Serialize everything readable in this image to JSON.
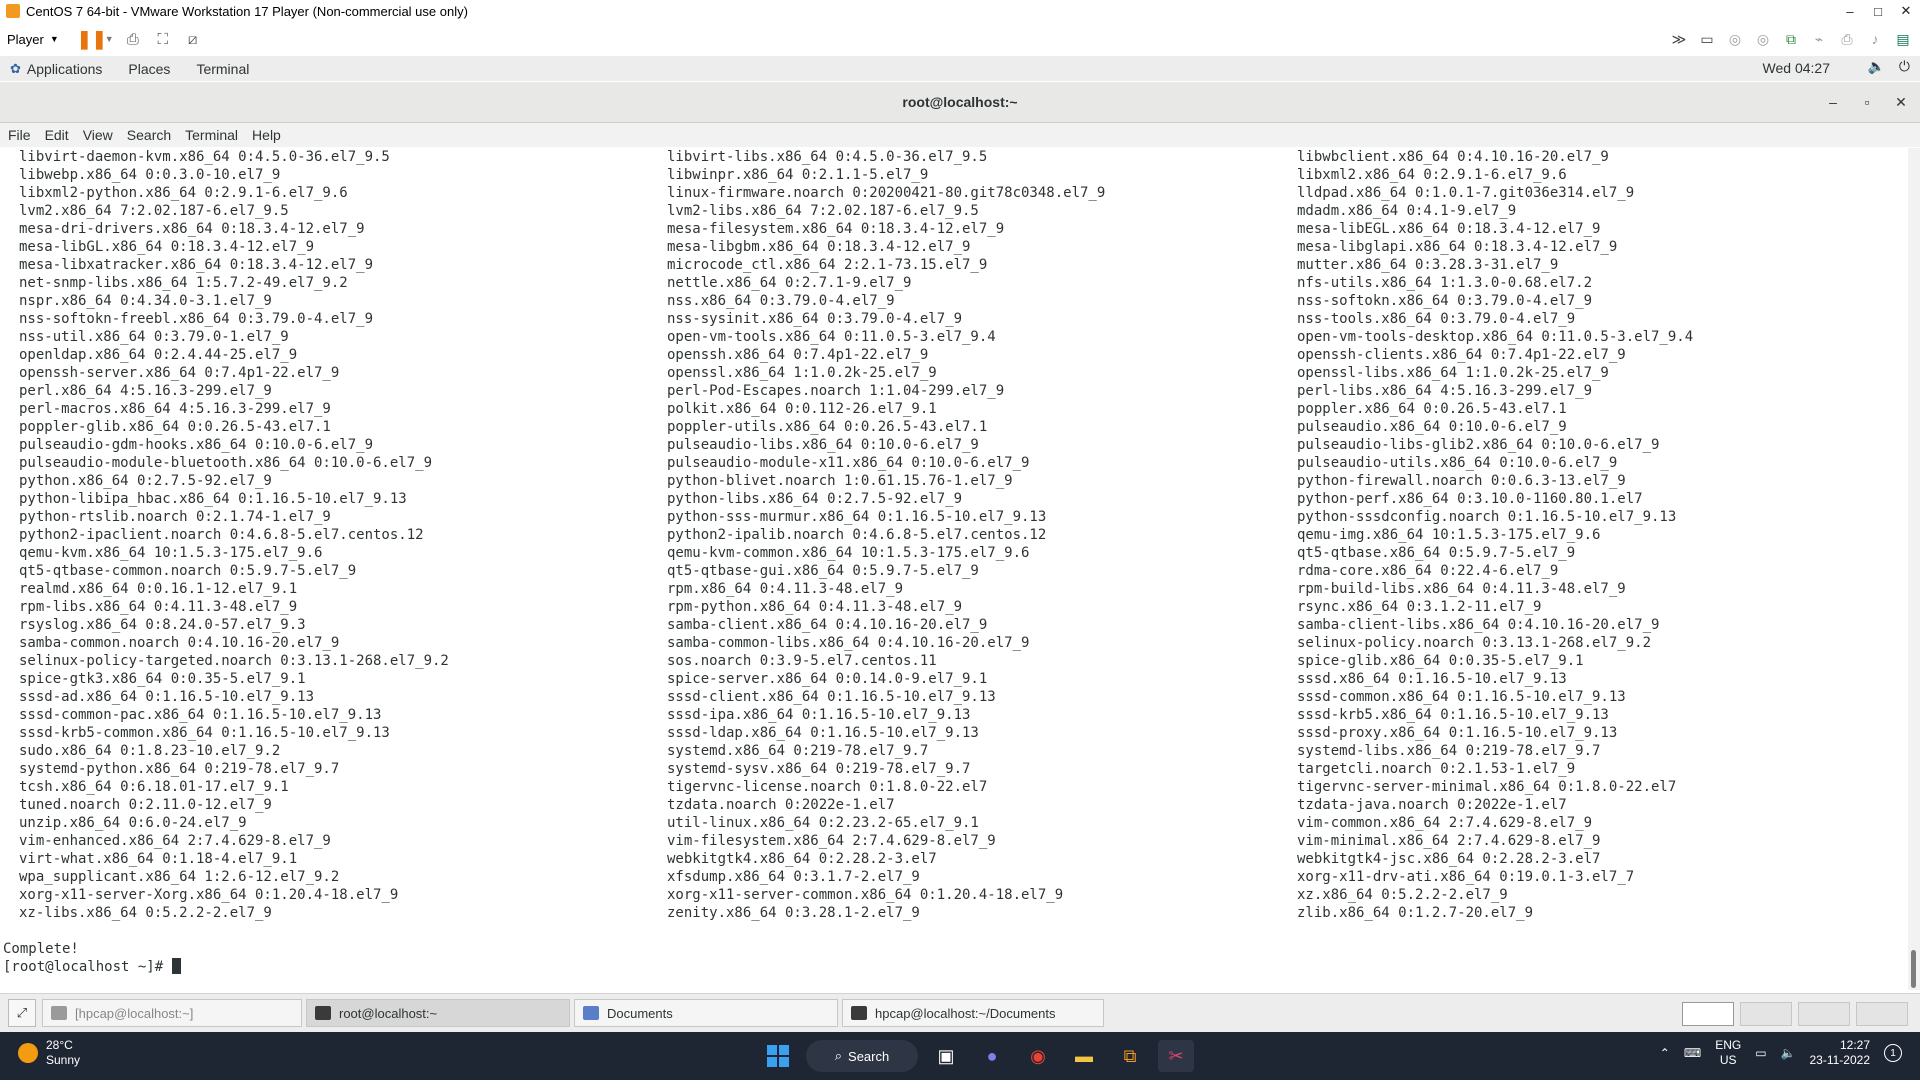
{
  "vm": {
    "title": "CentOS 7 64-bit - VMware Workstation 17 Player (Non-commercial use only)",
    "player_label": "Player",
    "minimize": "–",
    "maximize": "□",
    "close": "✕"
  },
  "gnome": {
    "menu": [
      "Applications",
      "Places",
      "Terminal"
    ],
    "clock": "Wed 04:27"
  },
  "terminal": {
    "title": "root@localhost:~",
    "menu": [
      "File",
      "Edit",
      "View",
      "Search",
      "Terminal",
      "Help"
    ],
    "rows": [
      [
        "libvirt-daemon-kvm.x86_64 0:4.5.0-36.el7_9.5",
        "libvirt-libs.x86_64 0:4.5.0-36.el7_9.5",
        "libwbclient.x86_64 0:4.10.16-20.el7_9"
      ],
      [
        "libwebp.x86_64 0:0.3.0-10.el7_9",
        "libwinpr.x86_64 0:2.1.1-5.el7_9",
        "libxml2.x86_64 0:2.9.1-6.el7_9.6"
      ],
      [
        "libxml2-python.x86_64 0:2.9.1-6.el7_9.6",
        "linux-firmware.noarch 0:20200421-80.git78c0348.el7_9",
        "lldpad.x86_64 0:1.0.1-7.git036e314.el7_9"
      ],
      [
        "lvm2.x86_64 7:2.02.187-6.el7_9.5",
        "lvm2-libs.x86_64 7:2.02.187-6.el7_9.5",
        "mdadm.x86_64 0:4.1-9.el7_9"
      ],
      [
        "mesa-dri-drivers.x86_64 0:18.3.4-12.el7_9",
        "mesa-filesystem.x86_64 0:18.3.4-12.el7_9",
        "mesa-libEGL.x86_64 0:18.3.4-12.el7_9"
      ],
      [
        "mesa-libGL.x86_64 0:18.3.4-12.el7_9",
        "mesa-libgbm.x86_64 0:18.3.4-12.el7_9",
        "mesa-libglapi.x86_64 0:18.3.4-12.el7_9"
      ],
      [
        "mesa-libxatracker.x86_64 0:18.3.4-12.el7_9",
        "microcode_ctl.x86_64 2:2.1-73.15.el7_9",
        "mutter.x86_64 0:3.28.3-31.el7_9"
      ],
      [
        "net-snmp-libs.x86_64 1:5.7.2-49.el7_9.2",
        "nettle.x86_64 0:2.7.1-9.el7_9",
        "nfs-utils.x86_64 1:1.3.0-0.68.el7.2"
      ],
      [
        "nspr.x86_64 0:4.34.0-3.1.el7_9",
        "nss.x86_64 0:3.79.0-4.el7_9",
        "nss-softokn.x86_64 0:3.79.0-4.el7_9"
      ],
      [
        "nss-softokn-freebl.x86_64 0:3.79.0-4.el7_9",
        "nss-sysinit.x86_64 0:3.79.0-4.el7_9",
        "nss-tools.x86_64 0:3.79.0-4.el7_9"
      ],
      [
        "nss-util.x86_64 0:3.79.0-1.el7_9",
        "open-vm-tools.x86_64 0:11.0.5-3.el7_9.4",
        "open-vm-tools-desktop.x86_64 0:11.0.5-3.el7_9.4"
      ],
      [
        "openldap.x86_64 0:2.4.44-25.el7_9",
        "openssh.x86_64 0:7.4p1-22.el7_9",
        "openssh-clients.x86_64 0:7.4p1-22.el7_9"
      ],
      [
        "openssh-server.x86_64 0:7.4p1-22.el7_9",
        "openssl.x86_64 1:1.0.2k-25.el7_9",
        "openssl-libs.x86_64 1:1.0.2k-25.el7_9"
      ],
      [
        "perl.x86_64 4:5.16.3-299.el7_9",
        "perl-Pod-Escapes.noarch 1:1.04-299.el7_9",
        "perl-libs.x86_64 4:5.16.3-299.el7_9"
      ],
      [
        "perl-macros.x86_64 4:5.16.3-299.el7_9",
        "polkit.x86_64 0:0.112-26.el7_9.1",
        "poppler.x86_64 0:0.26.5-43.el7.1"
      ],
      [
        "poppler-glib.x86_64 0:0.26.5-43.el7.1",
        "poppler-utils.x86_64 0:0.26.5-43.el7.1",
        "pulseaudio.x86_64 0:10.0-6.el7_9"
      ],
      [
        "pulseaudio-gdm-hooks.x86_64 0:10.0-6.el7_9",
        "pulseaudio-libs.x86_64 0:10.0-6.el7_9",
        "pulseaudio-libs-glib2.x86_64 0:10.0-6.el7_9"
      ],
      [
        "pulseaudio-module-bluetooth.x86_64 0:10.0-6.el7_9",
        "pulseaudio-module-x11.x86_64 0:10.0-6.el7_9",
        "pulseaudio-utils.x86_64 0:10.0-6.el7_9"
      ],
      [
        "python.x86_64 0:2.7.5-92.el7_9",
        "python-blivet.noarch 1:0.61.15.76-1.el7_9",
        "python-firewall.noarch 0:0.6.3-13.el7_9"
      ],
      [
        "python-libipa_hbac.x86_64 0:1.16.5-10.el7_9.13",
        "python-libs.x86_64 0:2.7.5-92.el7_9",
        "python-perf.x86_64 0:3.10.0-1160.80.1.el7"
      ],
      [
        "python-rtslib.noarch 0:2.1.74-1.el7_9",
        "python-sss-murmur.x86_64 0:1.16.5-10.el7_9.13",
        "python-sssdconfig.noarch 0:1.16.5-10.el7_9.13"
      ],
      [
        "python2-ipaclient.noarch 0:4.6.8-5.el7.centos.12",
        "python2-ipalib.noarch 0:4.6.8-5.el7.centos.12",
        "qemu-img.x86_64 10:1.5.3-175.el7_9.6"
      ],
      [
        "qemu-kvm.x86_64 10:1.5.3-175.el7_9.6",
        "qemu-kvm-common.x86_64 10:1.5.3-175.el7_9.6",
        "qt5-qtbase.x86_64 0:5.9.7-5.el7_9"
      ],
      [
        "qt5-qtbase-common.noarch 0:5.9.7-5.el7_9",
        "qt5-qtbase-gui.x86_64 0:5.9.7-5.el7_9",
        "rdma-core.x86_64 0:22.4-6.el7_9"
      ],
      [
        "realmd.x86_64 0:0.16.1-12.el7_9.1",
        "rpm.x86_64 0:4.11.3-48.el7_9",
        "rpm-build-libs.x86_64 0:4.11.3-48.el7_9"
      ],
      [
        "rpm-libs.x86_64 0:4.11.3-48.el7_9",
        "rpm-python.x86_64 0:4.11.3-48.el7_9",
        "rsync.x86_64 0:3.1.2-11.el7_9"
      ],
      [
        "rsyslog.x86_64 0:8.24.0-57.el7_9.3",
        "samba-client.x86_64 0:4.10.16-20.el7_9",
        "samba-client-libs.x86_64 0:4.10.16-20.el7_9"
      ],
      [
        "samba-common.noarch 0:4.10.16-20.el7_9",
        "samba-common-libs.x86_64 0:4.10.16-20.el7_9",
        "selinux-policy.noarch 0:3.13.1-268.el7_9.2"
      ],
      [
        "selinux-policy-targeted.noarch 0:3.13.1-268.el7_9.2",
        "sos.noarch 0:3.9-5.el7.centos.11",
        "spice-glib.x86_64 0:0.35-5.el7_9.1"
      ],
      [
        "spice-gtk3.x86_64 0:0.35-5.el7_9.1",
        "spice-server.x86_64 0:0.14.0-9.el7_9.1",
        "sssd.x86_64 0:1.16.5-10.el7_9.13"
      ],
      [
        "sssd-ad.x86_64 0:1.16.5-10.el7_9.13",
        "sssd-client.x86_64 0:1.16.5-10.el7_9.13",
        "sssd-common.x86_64 0:1.16.5-10.el7_9.13"
      ],
      [
        "sssd-common-pac.x86_64 0:1.16.5-10.el7_9.13",
        "sssd-ipa.x86_64 0:1.16.5-10.el7_9.13",
        "sssd-krb5.x86_64 0:1.16.5-10.el7_9.13"
      ],
      [
        "sssd-krb5-common.x86_64 0:1.16.5-10.el7_9.13",
        "sssd-ldap.x86_64 0:1.16.5-10.el7_9.13",
        "sssd-proxy.x86_64 0:1.16.5-10.el7_9.13"
      ],
      [
        "sudo.x86_64 0:1.8.23-10.el7_9.2",
        "systemd.x86_64 0:219-78.el7_9.7",
        "systemd-libs.x86_64 0:219-78.el7_9.7"
      ],
      [
        "systemd-python.x86_64 0:219-78.el7_9.7",
        "systemd-sysv.x86_64 0:219-78.el7_9.7",
        "targetcli.noarch 0:2.1.53-1.el7_9"
      ],
      [
        "tcsh.x86_64 0:6.18.01-17.el7_9.1",
        "tigervnc-license.noarch 0:1.8.0-22.el7",
        "tigervnc-server-minimal.x86_64 0:1.8.0-22.el7"
      ],
      [
        "tuned.noarch 0:2.11.0-12.el7_9",
        "tzdata.noarch 0:2022e-1.el7",
        "tzdata-java.noarch 0:2022e-1.el7"
      ],
      [
        "unzip.x86_64 0:6.0-24.el7_9",
        "util-linux.x86_64 0:2.23.2-65.el7_9.1",
        "vim-common.x86_64 2:7.4.629-8.el7_9"
      ],
      [
        "vim-enhanced.x86_64 2:7.4.629-8.el7_9",
        "vim-filesystem.x86_64 2:7.4.629-8.el7_9",
        "vim-minimal.x86_64 2:7.4.629-8.el7_9"
      ],
      [
        "virt-what.x86_64 0:1.18-4.el7_9.1",
        "webkitgtk4.x86_64 0:2.28.2-3.el7",
        "webkitgtk4-jsc.x86_64 0:2.28.2-3.el7"
      ],
      [
        "wpa_supplicant.x86_64 1:2.6-12.el7_9.2",
        "xfsdump.x86_64 0:3.1.7-2.el7_9",
        "xorg-x11-drv-ati.x86_64 0:19.0.1-3.el7_7"
      ],
      [
        "xorg-x11-server-Xorg.x86_64 0:1.20.4-18.el7_9",
        "xorg-x11-server-common.x86_64 0:1.20.4-18.el7_9",
        "xz.x86_64 0:5.2.2-2.el7_9"
      ],
      [
        "xz-libs.x86_64 0:5.2.2-2.el7_9",
        "zenity.x86_64 0:3.28.1-2.el7_9",
        "zlib.x86_64 0:1.2.7-20.el7_9"
      ]
    ],
    "complete_text": "Complete!",
    "prompt": "[root@localhost ~]# "
  },
  "tasks": [
    {
      "label": "[hpcap@localhost:~]",
      "state": "inactive"
    },
    {
      "label": "root@localhost:~",
      "state": "active"
    },
    {
      "label": "Documents",
      "state": "normal"
    },
    {
      "label": "hpcap@localhost:~/Documents",
      "state": "normal"
    }
  ],
  "windows": {
    "weather_temp": "28°C",
    "weather_desc": "Sunny",
    "search_label": "Search",
    "lang_top": "ENG",
    "lang_bottom": "US",
    "time": "12:27",
    "date": "23-11-2022",
    "notification_count": "1"
  }
}
